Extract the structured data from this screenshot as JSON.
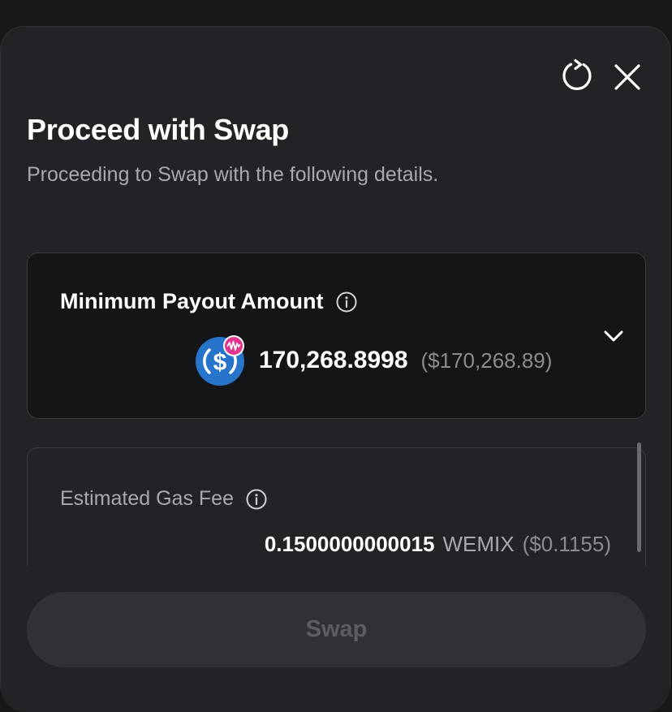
{
  "modal": {
    "title": "Proceed with Swap",
    "subtitle": "Proceeding to Swap with the following details."
  },
  "payout": {
    "label": "Minimum Payout Amount",
    "amount": "170,268.8998",
    "usd": "($170,268.89)",
    "token_icon": "usdc-wemix-token-icon"
  },
  "gas": {
    "label": "Estimated Gas Fee",
    "amount": "0.1500000000015",
    "symbol": "WEMIX",
    "usd": "($0.1155)"
  },
  "actions": {
    "swap_label": "Swap",
    "swap_enabled": false
  },
  "icons": {
    "refresh": "refresh-icon",
    "close": "close-icon",
    "info": "info-icon",
    "expand": "chevron-down-icon"
  },
  "colors": {
    "background": "#17181a",
    "panel": "#222326",
    "card_dark": "#141517",
    "text_primary": "#ffffff",
    "text_secondary": "#a7a9ad",
    "usdc_blue": "#2775ca",
    "wemix_pink": "#e0368f",
    "disabled_button": "#303134"
  }
}
